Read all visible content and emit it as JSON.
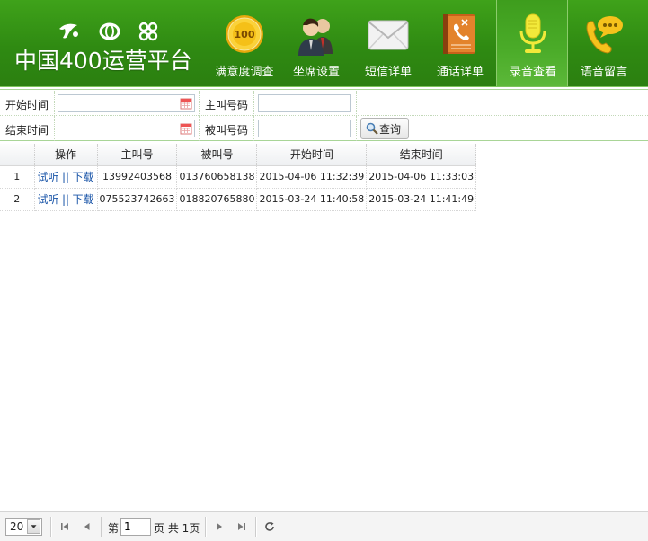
{
  "header": {
    "title": "中国400运营平台",
    "nav": [
      {
        "label": "满意度调查",
        "icon": "badge-100-icon"
      },
      {
        "label": "坐席设置",
        "icon": "agents-icon"
      },
      {
        "label": "短信详单",
        "icon": "envelope-icon"
      },
      {
        "label": "通话详单",
        "icon": "phone-book-icon"
      },
      {
        "label": "录音查看",
        "icon": "microphone-icon",
        "active": true
      },
      {
        "label": "语音留言",
        "icon": "phone-message-icon"
      }
    ]
  },
  "search": {
    "start_time_label": "开始时间",
    "end_time_label": "结束时间",
    "caller_label": "主叫号码",
    "callee_label": "被叫号码",
    "start_time_value": "",
    "end_time_value": "",
    "caller_value": "",
    "callee_value": "",
    "button_label": "查询"
  },
  "table": {
    "columns": [
      "",
      "操作",
      "主叫号",
      "被叫号",
      "开始时间",
      "结束时间"
    ],
    "action_listen": "试听",
    "action_sep": "||",
    "action_download": "下载",
    "rows": [
      {
        "num": "1",
        "caller": "13992403568",
        "callee": "013760658138",
        "start": "2015-04-06 11:32:39",
        "end": "2015-04-06 11:33:03"
      },
      {
        "num": "2",
        "caller": "075523742663",
        "callee": "018820765880",
        "start": "2015-03-24 11:40:58",
        "end": "2015-03-24 11:41:49"
      }
    ]
  },
  "pager": {
    "page_size": "20",
    "page_prefix": "第",
    "page_value": "1",
    "page_suffix": "页 共 1页"
  },
  "colors": {
    "header_green": "#2f8a12",
    "link_blue": "#1a55a8"
  }
}
